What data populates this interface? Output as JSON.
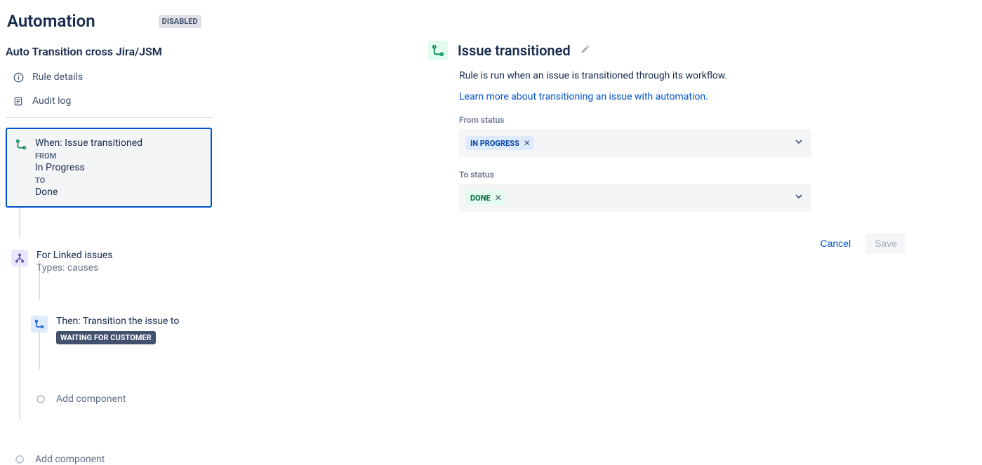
{
  "header": {
    "title": "Automation",
    "status_badge": "DISABLED"
  },
  "rule": {
    "name": "Auto Transition cross Jira/JSM",
    "nav": {
      "rule_details": "Rule details",
      "audit_log": "Audit log"
    },
    "trigger": {
      "title": "When: Issue transitioned",
      "from_label": "FROM",
      "from_value": "In Progress",
      "to_label": "TO",
      "to_value": "Done"
    },
    "branch": {
      "title": "For Linked issues",
      "subtitle": "Types: causes"
    },
    "action": {
      "title": "Then: Transition the issue to",
      "status_chip": "WAITING FOR CUSTOMER"
    },
    "add_component_inner": "Add component",
    "add_component_outer": "Add component"
  },
  "panel": {
    "title": "Issue transitioned",
    "description": "Rule is run when an issue is transitioned through its workflow.",
    "learn_more": "Learn more about transitioning an issue with automation.",
    "from_status_label": "From status",
    "from_status_value": "IN PROGRESS",
    "to_status_label": "To status",
    "to_status_value": "DONE",
    "cancel": "Cancel",
    "save": "Save"
  }
}
